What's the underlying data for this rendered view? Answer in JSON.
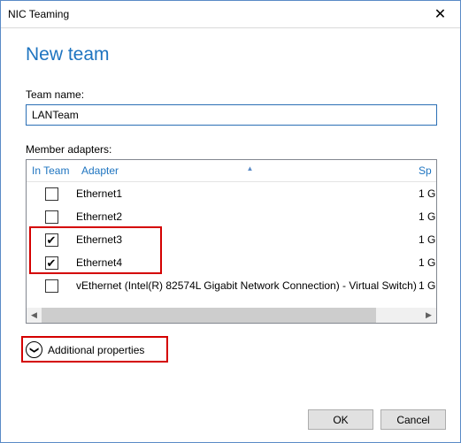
{
  "titlebar": {
    "title": "NIC Teaming"
  },
  "heading": "New team",
  "labels": {
    "team_name": "Team name:",
    "member_adapters": "Member adapters:"
  },
  "inputs": {
    "team_name_value": "LANTeam"
  },
  "columns": {
    "in_team": "In Team",
    "adapter": "Adapter",
    "speed": "Sp"
  },
  "rows": [
    {
      "checked": false,
      "adapter": "Ethernet1",
      "speed": "1 G"
    },
    {
      "checked": false,
      "adapter": "Ethernet2",
      "speed": "1 G"
    },
    {
      "checked": true,
      "adapter": "Ethernet3",
      "speed": "1 G"
    },
    {
      "checked": true,
      "adapter": "Ethernet4",
      "speed": "1 G"
    },
    {
      "checked": false,
      "adapter": "vEthernet (Intel(R) 82574L Gigabit Network Connection) - Virtual Switch)",
      "speed": "1 G"
    }
  ],
  "expander": {
    "label": "Additional properties"
  },
  "buttons": {
    "ok": "OK",
    "cancel": "Cancel"
  },
  "glyphs": {
    "close": "✕",
    "sort_up": "▲",
    "check": "✔",
    "chev_down": "❯",
    "tri_left": "◀",
    "tri_right": "▶"
  }
}
